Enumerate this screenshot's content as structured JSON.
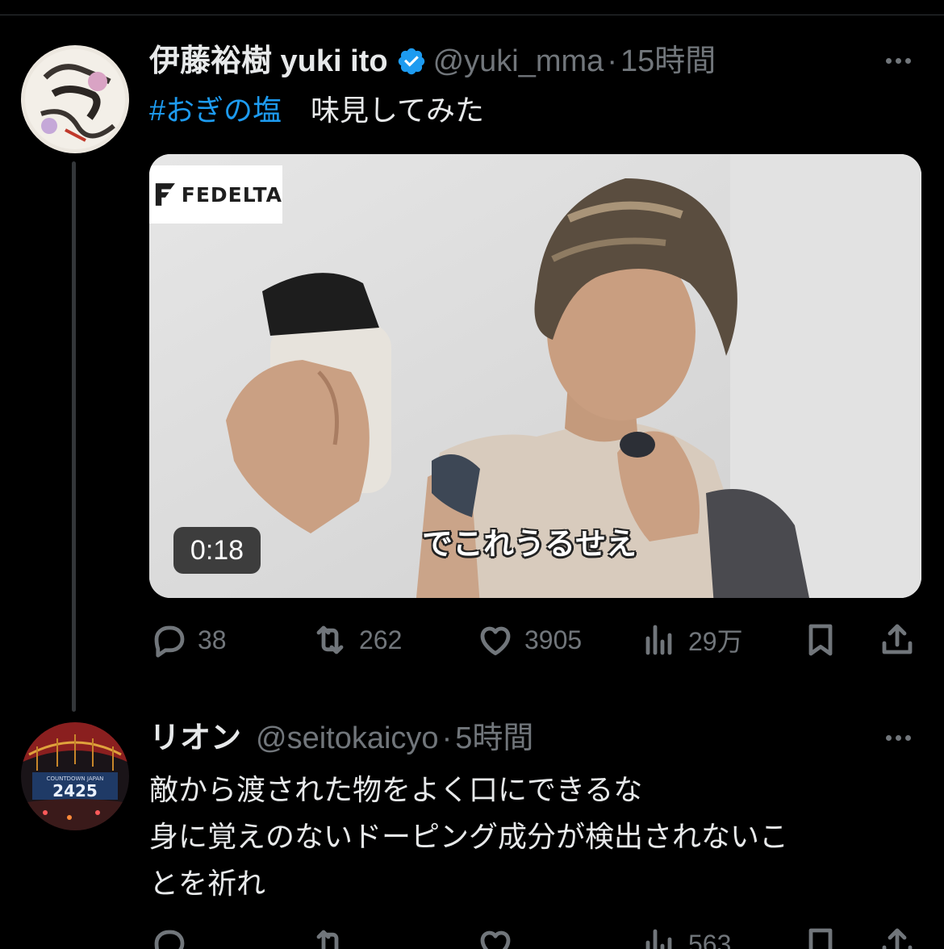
{
  "colors": {
    "background": "#000000",
    "text_primary": "#e7e9ea",
    "text_secondary": "#71767b",
    "accent": "#1d9bf0",
    "divider": "#2f3336"
  },
  "tweet": {
    "display_name": "伊藤裕樹 yuki ito",
    "verified": true,
    "verified_icon": "verified-badge-icon",
    "handle": "@yuki_mma",
    "separator": "·",
    "time": "15時間",
    "more_icon": "more-icon",
    "text_hashtag": "#おぎの塩",
    "text_body": "　味見してみた",
    "media": {
      "type": "video",
      "logo_text": "FEDELTA",
      "caption": "でこれうるせえ",
      "duration": "0:18"
    },
    "actions": {
      "reply": {
        "icon": "reply-icon",
        "count": "38"
      },
      "retweet": {
        "icon": "retweet-icon",
        "count": "262"
      },
      "like": {
        "icon": "heart-icon",
        "count": "3905"
      },
      "views": {
        "icon": "views-icon",
        "count": "29万"
      },
      "bookmark": {
        "icon": "bookmark-icon"
      },
      "share": {
        "icon": "share-icon"
      }
    }
  },
  "reply": {
    "display_name": "リオン",
    "handle": "@seitokaicyo",
    "separator": "·",
    "time": "5時間",
    "more_icon": "more-icon",
    "text_lines": [
      "敵から渡された物をよく口にできるな",
      "身に覚えのないドーピング成分が検出されないこ",
      "とを祈れ"
    ],
    "actions": {
      "views_count": "563"
    }
  }
}
